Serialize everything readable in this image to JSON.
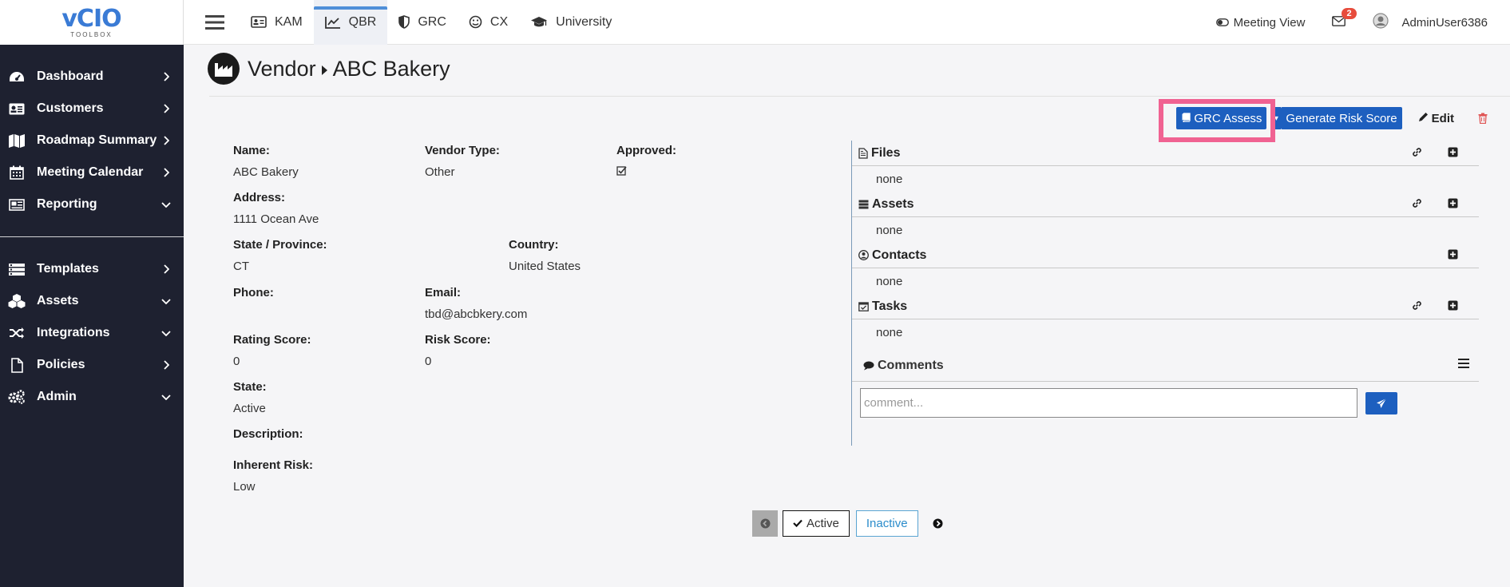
{
  "brand": {
    "logo_text": "vCIO",
    "logo_sub": "TOOLBOX"
  },
  "sidebar": {
    "items": [
      {
        "label": "Dashboard",
        "icon": "dashboard-icon",
        "chevron": "right"
      },
      {
        "label": "Customers",
        "icon": "id-card-icon",
        "chevron": "right"
      },
      {
        "label": "Roadmap Summary",
        "icon": "map-icon",
        "chevron": "right"
      },
      {
        "label": "Meeting Calendar",
        "icon": "calendar-icon",
        "chevron": "right"
      },
      {
        "label": "Reporting",
        "icon": "newspaper-icon",
        "chevron": "down"
      }
    ],
    "items2": [
      {
        "label": "Templates",
        "icon": "list-icon",
        "chevron": "right"
      },
      {
        "label": "Assets",
        "icon": "cubes-icon",
        "chevron": "down"
      },
      {
        "label": "Integrations",
        "icon": "random-icon",
        "chevron": "down"
      },
      {
        "label": "Policies",
        "icon": "file-icon",
        "chevron": "right"
      },
      {
        "label": "Admin",
        "icon": "cogs-icon",
        "chevron": "down"
      }
    ]
  },
  "topbar": {
    "tabs": [
      {
        "label": "KAM",
        "icon": "address-card-icon"
      },
      {
        "label": "QBR",
        "icon": "line-chart-icon",
        "active": true
      },
      {
        "label": "GRC",
        "icon": "shield-icon"
      },
      {
        "label": "CX",
        "icon": "smile-icon"
      },
      {
        "label": "University",
        "icon": "graduation-cap-icon"
      }
    ],
    "meeting_view": "Meeting View",
    "mail_count": "2",
    "username": "AdminUser6386"
  },
  "page": {
    "crumb_parent": "Vendor",
    "crumb_current": "ABC Bakery"
  },
  "actions": {
    "grc_assess": "GRC Assess",
    "generate_risk": "Generate Risk Score",
    "edit": "Edit"
  },
  "details": {
    "name_label": "Name:",
    "name": "ABC Bakery",
    "vendor_type_label": "Vendor Type:",
    "vendor_type": "Other",
    "approved_label": "Approved:",
    "address_label": "Address:",
    "address": "1111 Ocean Ave",
    "state_province_label": "State / Province:",
    "state_province": "CT",
    "country_label": "Country:",
    "country": "United States",
    "phone_label": "Phone:",
    "phone": "",
    "email_label": "Email:",
    "email": "tbd@abcbkery.com",
    "rating_label": "Rating Score:",
    "rating": "0",
    "risk_label": "Risk Score:",
    "risk": "0",
    "state_label": "State:",
    "state": "Active",
    "description_label": "Description:",
    "description": "",
    "inherent_label": "Inherent Risk:",
    "inherent": "Low"
  },
  "panel": {
    "files": {
      "title": "Files",
      "value": "none"
    },
    "assets": {
      "title": "Assets",
      "value": "none"
    },
    "contacts": {
      "title": "Contacts",
      "value": "none"
    },
    "tasks": {
      "title": "Tasks",
      "value": "none"
    },
    "comments": {
      "title": "Comments",
      "placeholder": "comment..."
    }
  },
  "pager": {
    "active": "Active",
    "inactive": "Inactive"
  }
}
